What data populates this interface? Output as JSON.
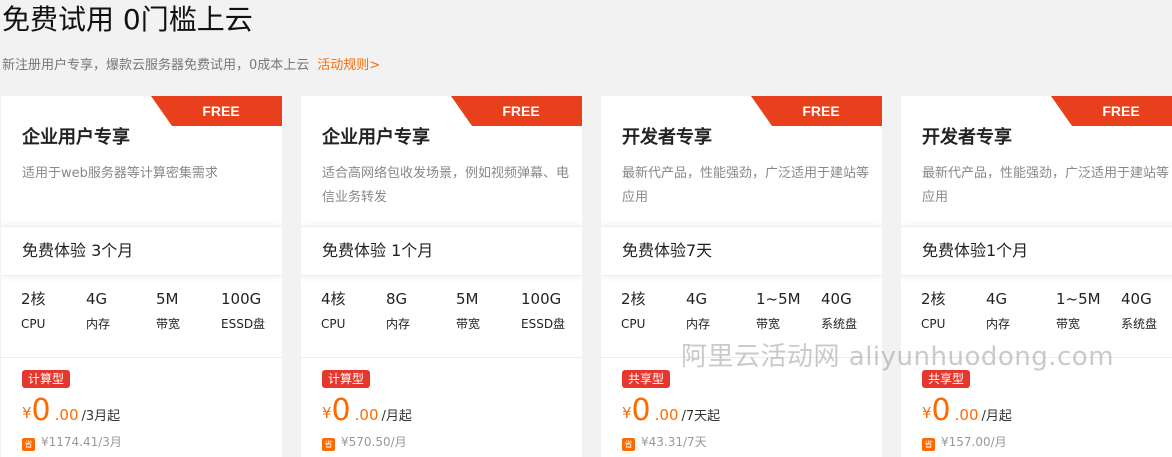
{
  "page": {
    "title": "免费试用 0门槛上云",
    "subtitle": "新注册用户专享，爆款云服务器免费试用，0成本上云",
    "rules_link": "活动规则>"
  },
  "colors": {
    "accent": "#ff6a00",
    "free_tag": "#e8401c",
    "badge": "#e5372d"
  },
  "cards": [
    {
      "tag": "FREE",
      "name": "企业用户专享",
      "desc": "适用于web服务器等计算密集需求",
      "trial": "免费体验 3个月",
      "specs": [
        {
          "value": "2核",
          "label": "CPU"
        },
        {
          "value": "4G",
          "label": "内存"
        },
        {
          "value": "5M",
          "label": "带宽"
        },
        {
          "value": "100G",
          "label": "ESSD盘"
        }
      ],
      "badge": "计算型",
      "price": {
        "currency": "¥",
        "int": "0",
        "dec": ".00",
        "unit": "/3月起"
      },
      "save_icon": "省",
      "original": "¥1174.41/3月"
    },
    {
      "tag": "FREE",
      "name": "企业用户专享",
      "desc": "适合高网络包收发场景，例如视频弹幕、电信业务转发",
      "trial": "免费体验 1个月",
      "specs": [
        {
          "value": "4核",
          "label": "CPU"
        },
        {
          "value": "8G",
          "label": "内存"
        },
        {
          "value": "5M",
          "label": "带宽"
        },
        {
          "value": "100G",
          "label": "ESSD盘"
        }
      ],
      "badge": "计算型",
      "price": {
        "currency": "¥",
        "int": "0",
        "dec": ".00",
        "unit": "/月起"
      },
      "save_icon": "省",
      "original": "¥570.50/月"
    },
    {
      "tag": "FREE",
      "name": "开发者专享",
      "desc": "最新代产品，性能强劲，广泛适用于建站等应用",
      "trial": "免费体验7天",
      "specs": [
        {
          "value": "2核",
          "label": "CPU"
        },
        {
          "value": "4G",
          "label": "内存"
        },
        {
          "value": "1~5M",
          "label": "带宽"
        },
        {
          "value": "40G",
          "label": "系统盘"
        }
      ],
      "badge": "共享型",
      "price": {
        "currency": "¥",
        "int": "0",
        "dec": ".00",
        "unit": "/7天起"
      },
      "save_icon": "省",
      "original": "¥43.31/7天"
    },
    {
      "tag": "FREE",
      "name": "开发者专享",
      "desc": "最新代产品，性能强劲，广泛适用于建站等应用",
      "trial": "免费体验1个月",
      "specs": [
        {
          "value": "2核",
          "label": "CPU"
        },
        {
          "value": "4G",
          "label": "内存"
        },
        {
          "value": "1~5M",
          "label": "带宽"
        },
        {
          "value": "40G",
          "label": "系统盘"
        }
      ],
      "badge": "共享型",
      "price": {
        "currency": "¥",
        "int": "0",
        "dec": ".00",
        "unit": "/月起"
      },
      "save_icon": "省",
      "original": "¥157.00/月"
    }
  ],
  "watermark": "阿里云活动网 aliyunhuodong.com"
}
